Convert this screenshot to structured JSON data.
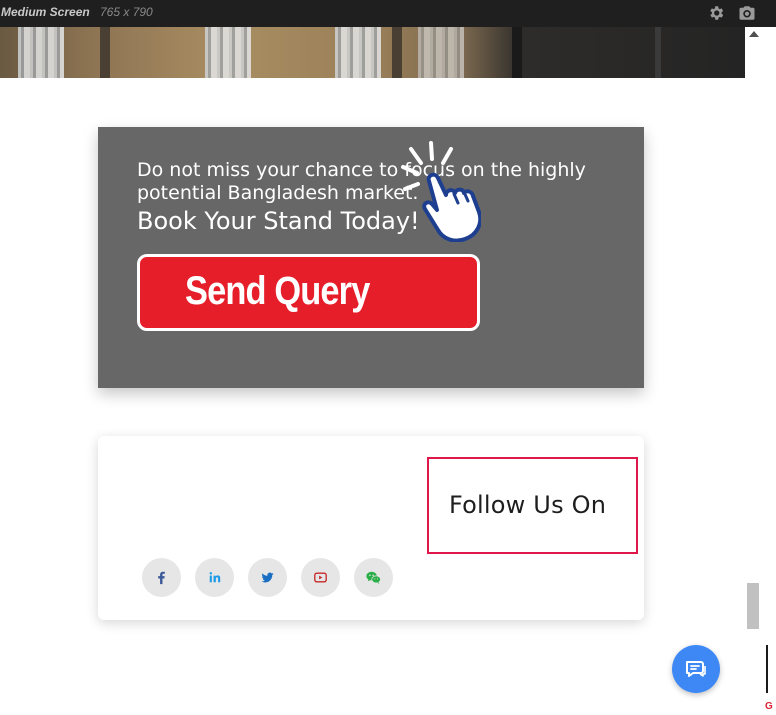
{
  "toolbar": {
    "title": "Medium Screen",
    "dimensions": "765 x 790",
    "icons": [
      "gear-icon",
      "camera-icon"
    ]
  },
  "cta": {
    "line1": "Do not miss your chance to focus on the highly potential Bangladesh market.",
    "line2": "Book Your Stand Today!",
    "button_label": "Send Query",
    "background": "#676767",
    "button_color": "#e61e2a"
  },
  "follow": {
    "title": "Follow Us On",
    "highlight_color": "#e0174b",
    "socials": [
      {
        "name": "facebook",
        "icon": "facebook-icon",
        "color": "#3b5998"
      },
      {
        "name": "linkedin",
        "icon": "linkedin-icon",
        "color": "#1d9be8"
      },
      {
        "name": "twitter",
        "icon": "twitter-icon",
        "color": "#1a6fc2"
      },
      {
        "name": "youtube",
        "icon": "youtube-icon",
        "color": "#c62828"
      },
      {
        "name": "wechat",
        "icon": "wechat-icon",
        "color": "#2aae47"
      }
    ]
  },
  "chat": {
    "icon": "chat-icon",
    "color": "#3d88f5"
  },
  "side_marker": "G"
}
